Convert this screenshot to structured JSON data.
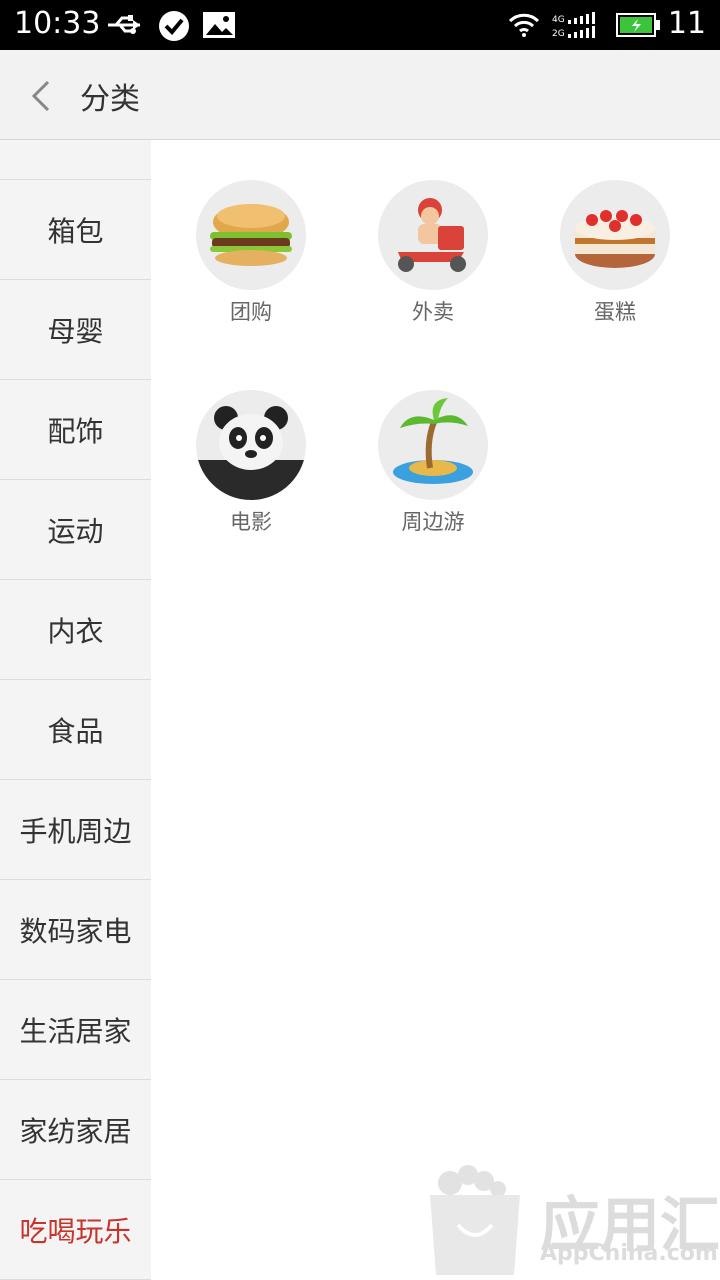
{
  "status_bar": {
    "time": "10:33",
    "right_number": "11"
  },
  "header": {
    "title": "分类"
  },
  "sidebar": {
    "items": [
      {
        "label": "箱包"
      },
      {
        "label": "母婴"
      },
      {
        "label": "配饰"
      },
      {
        "label": "运动"
      },
      {
        "label": "内衣"
      },
      {
        "label": "食品"
      },
      {
        "label": "手机周边"
      },
      {
        "label": "数码家电"
      },
      {
        "label": "生活居家"
      },
      {
        "label": "家纺家居"
      },
      {
        "label": "吃喝玩乐"
      }
    ],
    "active_index": 10
  },
  "categories": [
    {
      "label": "团购",
      "icon": "burger-icon"
    },
    {
      "label": "外卖",
      "icon": "delivery-scooter-icon"
    },
    {
      "label": "蛋糕",
      "icon": "cake-icon"
    },
    {
      "label": "电影",
      "icon": "panda-icon"
    },
    {
      "label": "周边游",
      "icon": "palm-island-icon"
    }
  ],
  "watermark": {
    "brand": "应用汇",
    "site": "AppChina.com"
  },
  "colors": {
    "active": "#c8342c",
    "statusbar": "#000000",
    "header_bg": "#f2f2f2"
  }
}
